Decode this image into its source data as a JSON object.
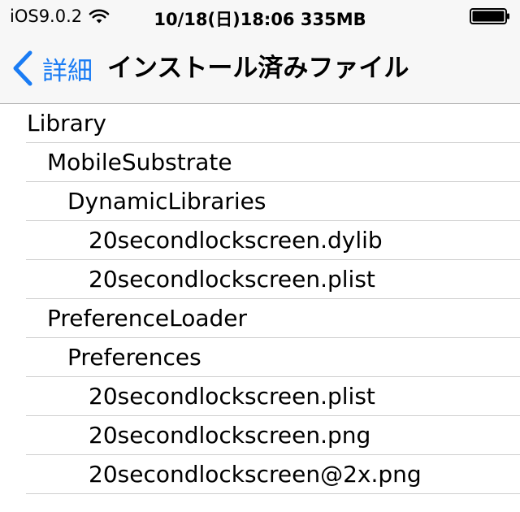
{
  "status_bar": {
    "carrier": "iOS9.0.2",
    "datetime_info": "10/18(日)18:06 335MB",
    "icons": [
      "wifi-icon",
      "battery-icon"
    ]
  },
  "nav": {
    "back_label": "詳細",
    "title": "インストール済みファイル",
    "accent_color": "#1a7cf4"
  },
  "files": [
    {
      "name": "Library",
      "level": 0
    },
    {
      "name": "MobileSubstrate",
      "level": 1
    },
    {
      "name": "DynamicLibraries",
      "level": 2
    },
    {
      "name": "20secondlockscreen.dylib",
      "level": 3
    },
    {
      "name": "20secondlockscreen.plist",
      "level": 3
    },
    {
      "name": "PreferenceLoader",
      "level": 1
    },
    {
      "name": "Preferences",
      "level": 2
    },
    {
      "name": "20secondlockscreen.plist",
      "level": 3
    },
    {
      "name": "20secondlockscreen.png",
      "level": 3
    },
    {
      "name": "20secondlockscreen@2x.png",
      "level": 3
    }
  ]
}
